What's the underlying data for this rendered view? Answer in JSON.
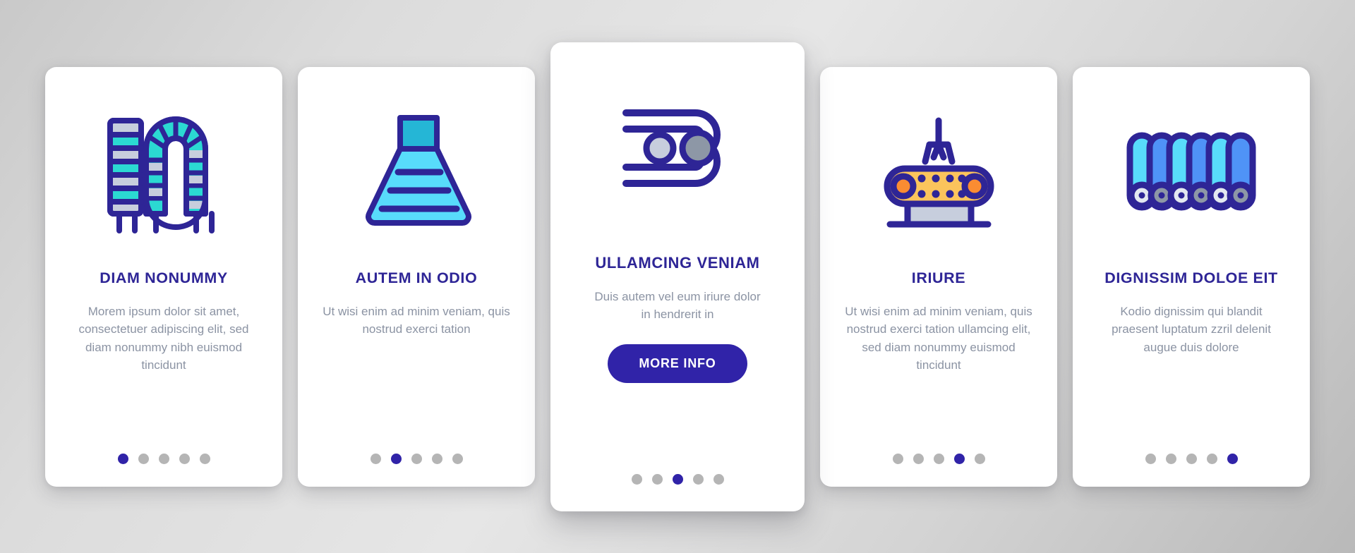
{
  "page": {
    "background_color": "#d8d8d8",
    "accent_color": "#3023a8",
    "title_color": "#2e2596",
    "body_text_color": "#8b93a3",
    "dot_inactive_color": "#b5b5b5"
  },
  "cards": [
    {
      "id": "card-1",
      "featured": false,
      "icon": "coil-spring-icon",
      "title": "DIAM NONUMMY",
      "body": "Morem ipsum dolor sit amet, consectetuer adipiscing elit, sed diam nonummy nibh euismod tincidunt",
      "dots": {
        "count": 5,
        "active_index": 0
      }
    },
    {
      "id": "card-2",
      "featured": false,
      "icon": "funnel-hopper-icon",
      "title": "AUTEM IN ODIO",
      "body": "Ut wisi enim ad minim veniam, quis nostrud exerci tation",
      "dots": {
        "count": 5,
        "active_index": 1
      }
    },
    {
      "id": "card-3",
      "featured": true,
      "icon": "belt-loop-rollers-icon",
      "title": "ULLAMCING VENIAM",
      "body": "Duis autem vel eum iriure dolor in hendrerit in",
      "button_label": "MORE INFO",
      "dots": {
        "count": 5,
        "active_index": 2
      }
    },
    {
      "id": "card-4",
      "featured": false,
      "icon": "conveyor-claw-icon",
      "title": "IRIURE",
      "body": "Ut wisi enim ad minim veniam, quis nostrud exerci tation ullamcing elit, sed diam nonummy euismod tincidunt",
      "dots": {
        "count": 5,
        "active_index": 3
      }
    },
    {
      "id": "card-5",
      "featured": false,
      "icon": "roller-bank-icon",
      "title": "DIGNISSIM DOLOE EIT",
      "body": "Kodio dignissim qui blandit praesent luptatum zzril delenit augue duis dolore",
      "dots": {
        "count": 5,
        "active_index": 4
      }
    }
  ]
}
